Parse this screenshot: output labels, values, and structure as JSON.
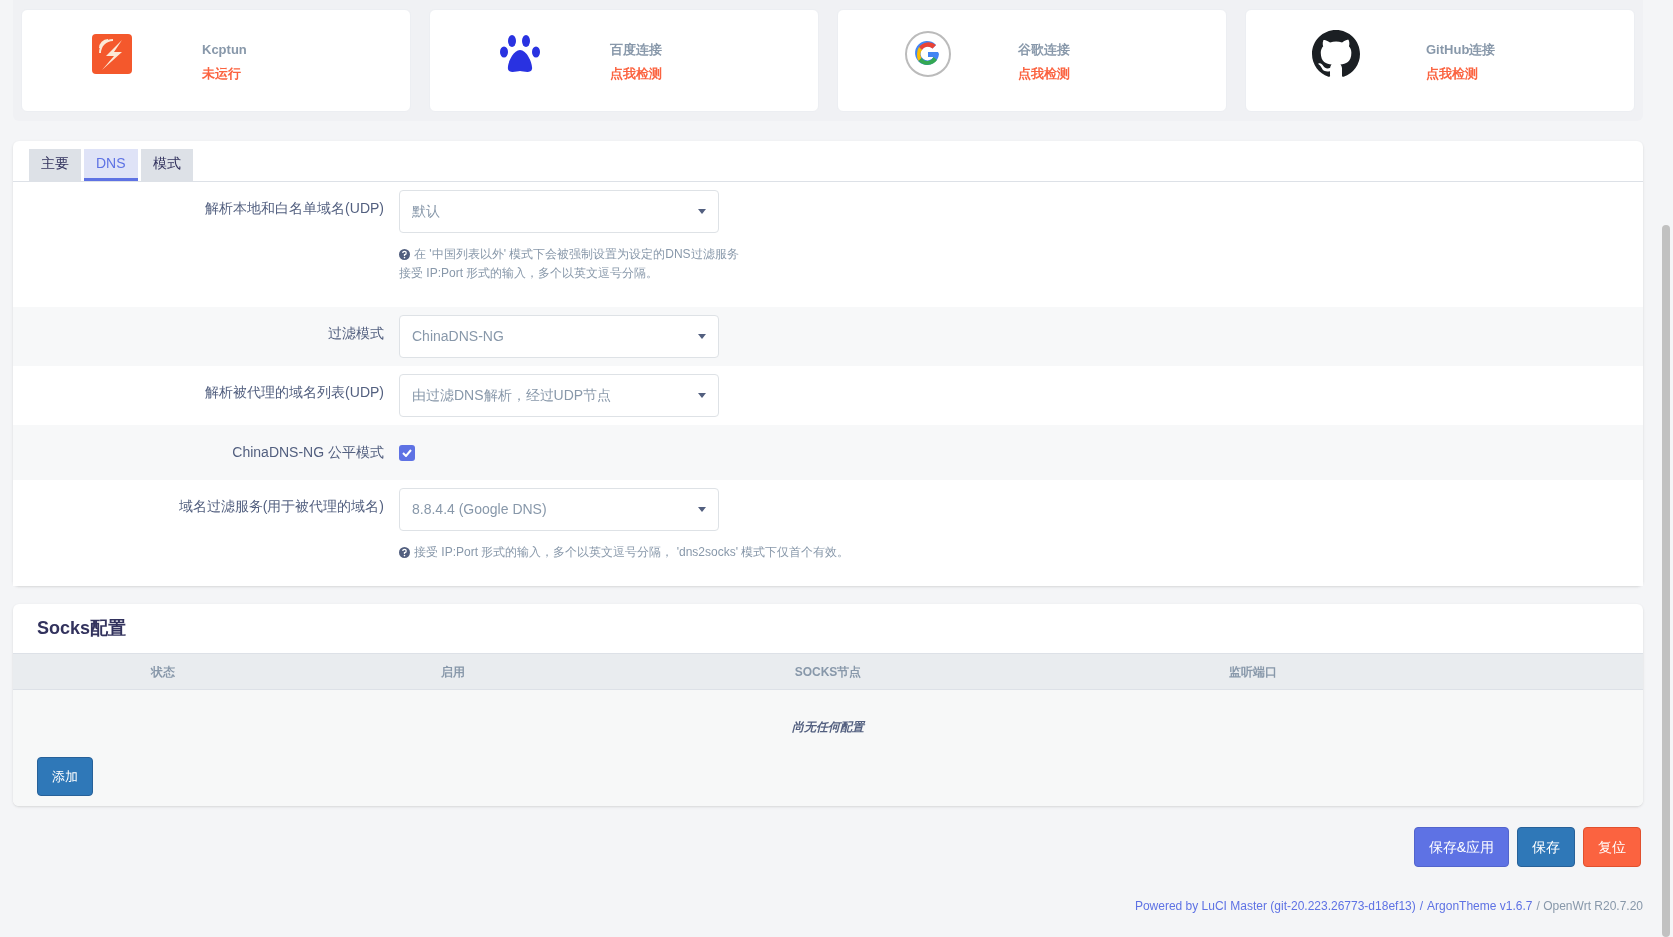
{
  "status_cards": [
    {
      "kind": "kcptun",
      "title": "Kcptun",
      "status": "未运行"
    },
    {
      "kind": "baidu",
      "title": "百度连接",
      "status": "点我检测"
    },
    {
      "kind": "google",
      "title": "谷歌连接",
      "status": "点我检测"
    },
    {
      "kind": "github",
      "title": "GitHub连接",
      "status": "点我检测"
    }
  ],
  "tabs": [
    {
      "label": "主要",
      "selected": false
    },
    {
      "label": "DNS",
      "selected": true
    },
    {
      "label": "模式",
      "selected": false
    }
  ],
  "fields": [
    {
      "kind": "select",
      "label": "解析本地和白名单域名(UDP)",
      "value": "默认",
      "help": [
        "在 '中国列表以外' 模式下会被强制设置为设定的DNS过滤服务",
        "接受 IP:Port 形式的输入，多个以英文逗号分隔。"
      ]
    },
    {
      "kind": "select",
      "label": "过滤模式",
      "value": "ChinaDNS-NG"
    },
    {
      "kind": "select",
      "label": "解析被代理的域名列表(UDP)",
      "value": "由过滤DNS解析，经过UDP节点"
    },
    {
      "kind": "checkbox",
      "label": "ChinaDNS-NG 公平模式",
      "checked": true
    },
    {
      "kind": "select",
      "label": "域名过滤服务(用于被代理的域名)",
      "value": "8.8.4.4 (Google DNS)",
      "help": [
        "接受 IP:Port 形式的输入，多个以英文逗号分隔， 'dns2socks' 模式下仅首个有效。"
      ]
    }
  ],
  "socks": {
    "title": "Socks配置",
    "columns": [
      "状态",
      "启用",
      "SOCKS节点",
      "监听端口"
    ],
    "empty_message": "尚无任何配置",
    "add_button": "添加"
  },
  "buttons": [
    {
      "kind": "apply",
      "label": "保存&应用"
    },
    {
      "kind": "save",
      "label": "保存"
    },
    {
      "kind": "reset",
      "label": "复位"
    }
  ],
  "footer": {
    "luci_link": "Powered by LuCI Master (git-20.223.26773-d18ef13)",
    "separator": "/",
    "theme_link": "ArgonTheme v1.6.7",
    "version": "/ OpenWrt R20.7.20"
  }
}
